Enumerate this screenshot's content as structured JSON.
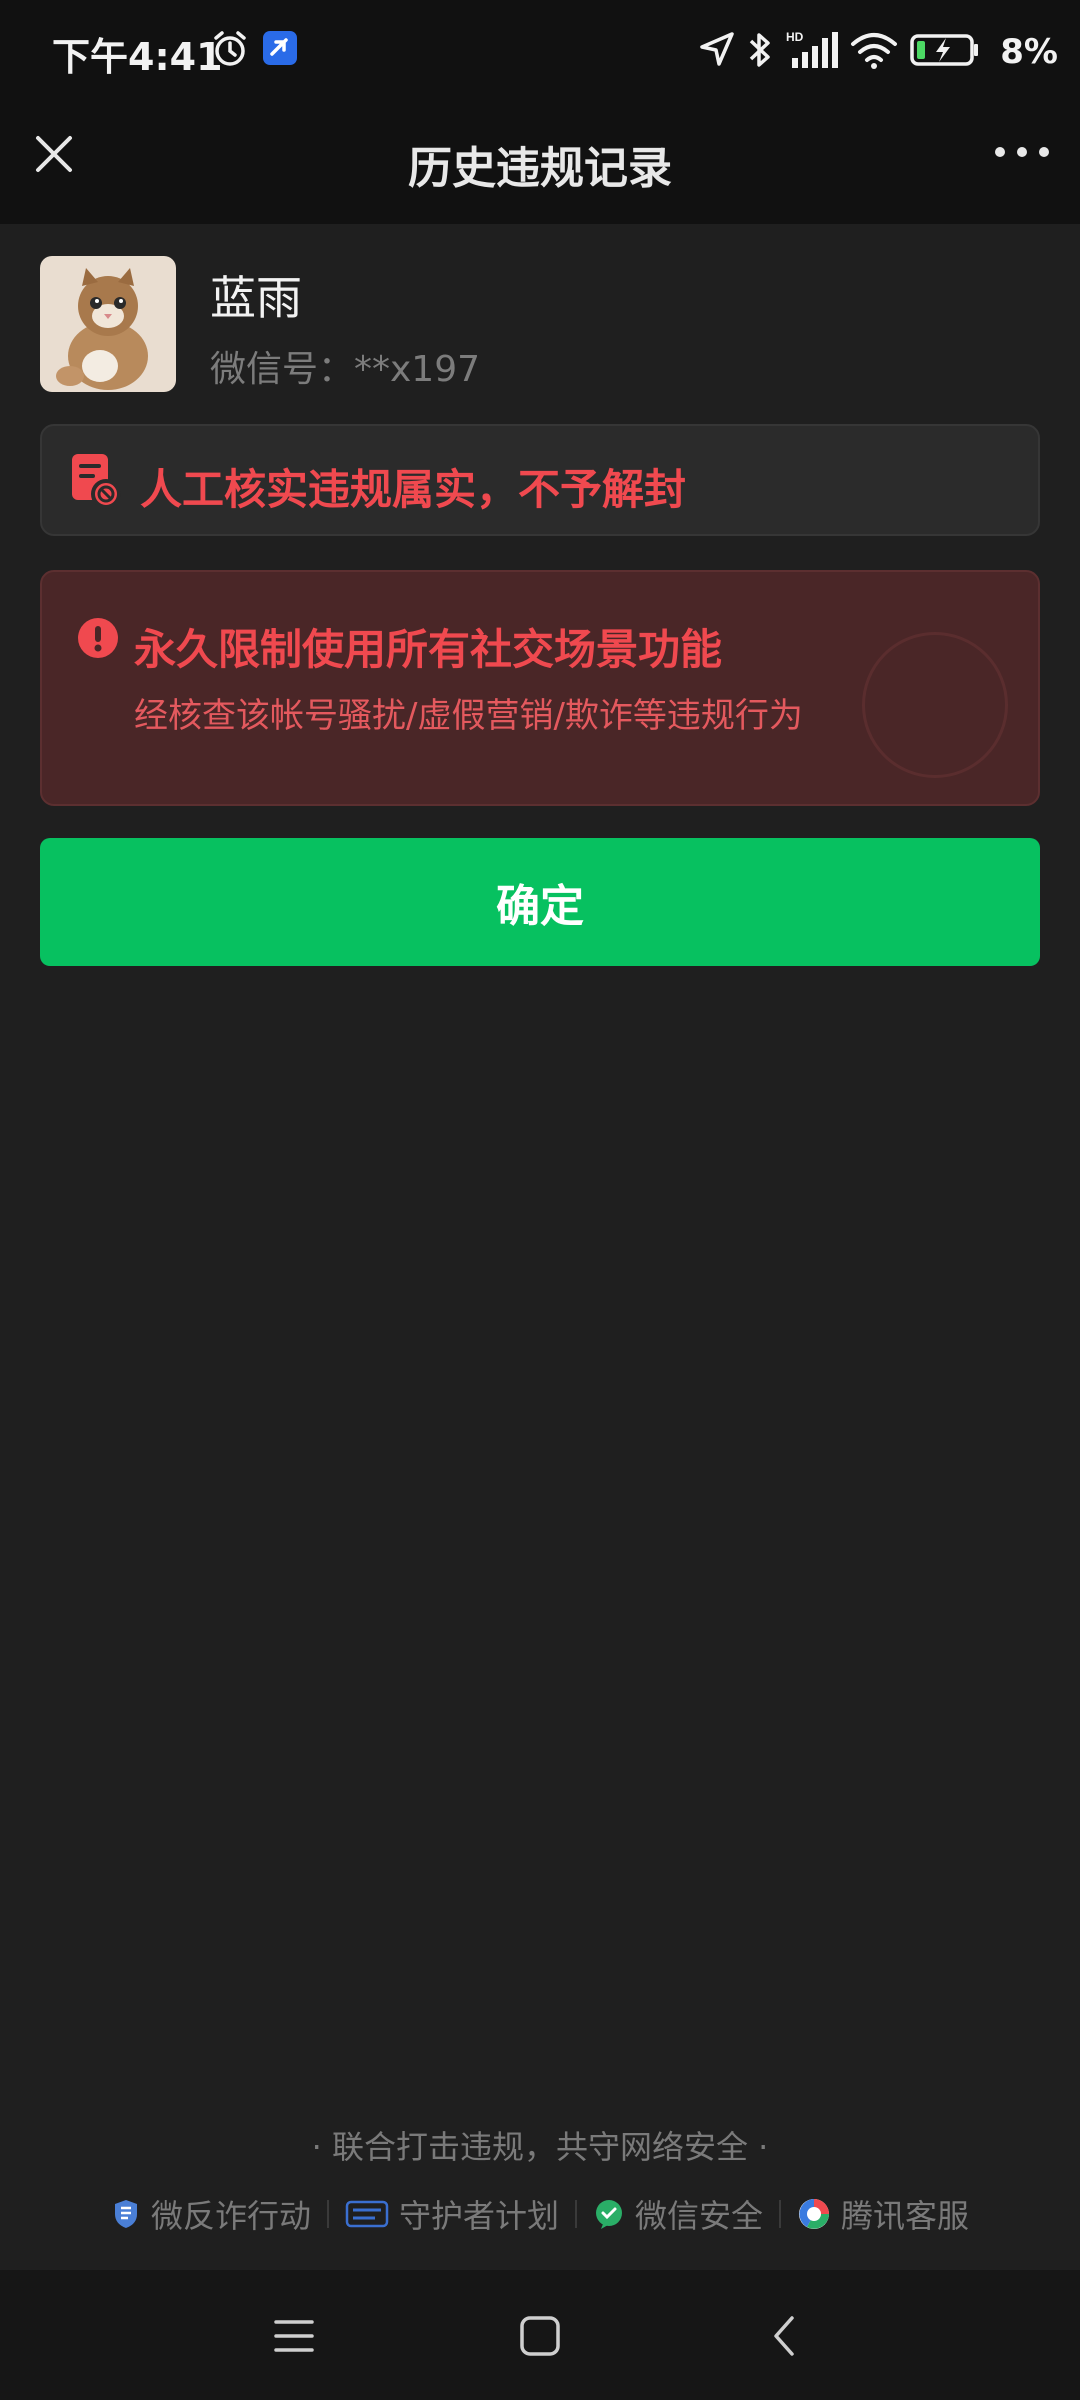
{
  "status_bar": {
    "time": "下午4:41",
    "battery": "8%",
    "icons": [
      "alarm-icon",
      "app-notification-icon",
      "location-icon",
      "bluetooth-icon",
      "signal-icon",
      "wifi-icon",
      "battery-charging-icon"
    ]
  },
  "nav": {
    "title": "历史违规记录",
    "close_icon": "close-icon",
    "more_icon": "more-icon"
  },
  "profile": {
    "nickname": "蓝雨",
    "wechat_id": "微信号：**x197"
  },
  "review": {
    "text": "人工核实违规属实，不予解封",
    "icon": "document-ban-icon"
  },
  "restriction": {
    "title": "永久限制使用所有社交场景功能",
    "description": "经核查该帐号骚扰/虚假营销/欺诈等违规行为",
    "icon": "alert-icon"
  },
  "confirm_button": {
    "label": "确定"
  },
  "footer": {
    "slogan": "· 联合打击违规，共守网络安全 ·",
    "links": [
      {
        "label": "微反诈行动",
        "icon": "anti-fraud-icon"
      },
      {
        "label": "守护者计划",
        "icon": "guardian-plan-icon"
      },
      {
        "label": "微信安全",
        "icon": "wechat-security-icon"
      },
      {
        "label": "腾讯客服",
        "icon": "tencent-service-icon"
      }
    ]
  },
  "colors": {
    "accent_green": "#07c160",
    "alert_red": "#f0494f",
    "background": "#1f1f1f"
  },
  "system_nav": [
    "menu-icon",
    "home-icon",
    "back-icon"
  ]
}
